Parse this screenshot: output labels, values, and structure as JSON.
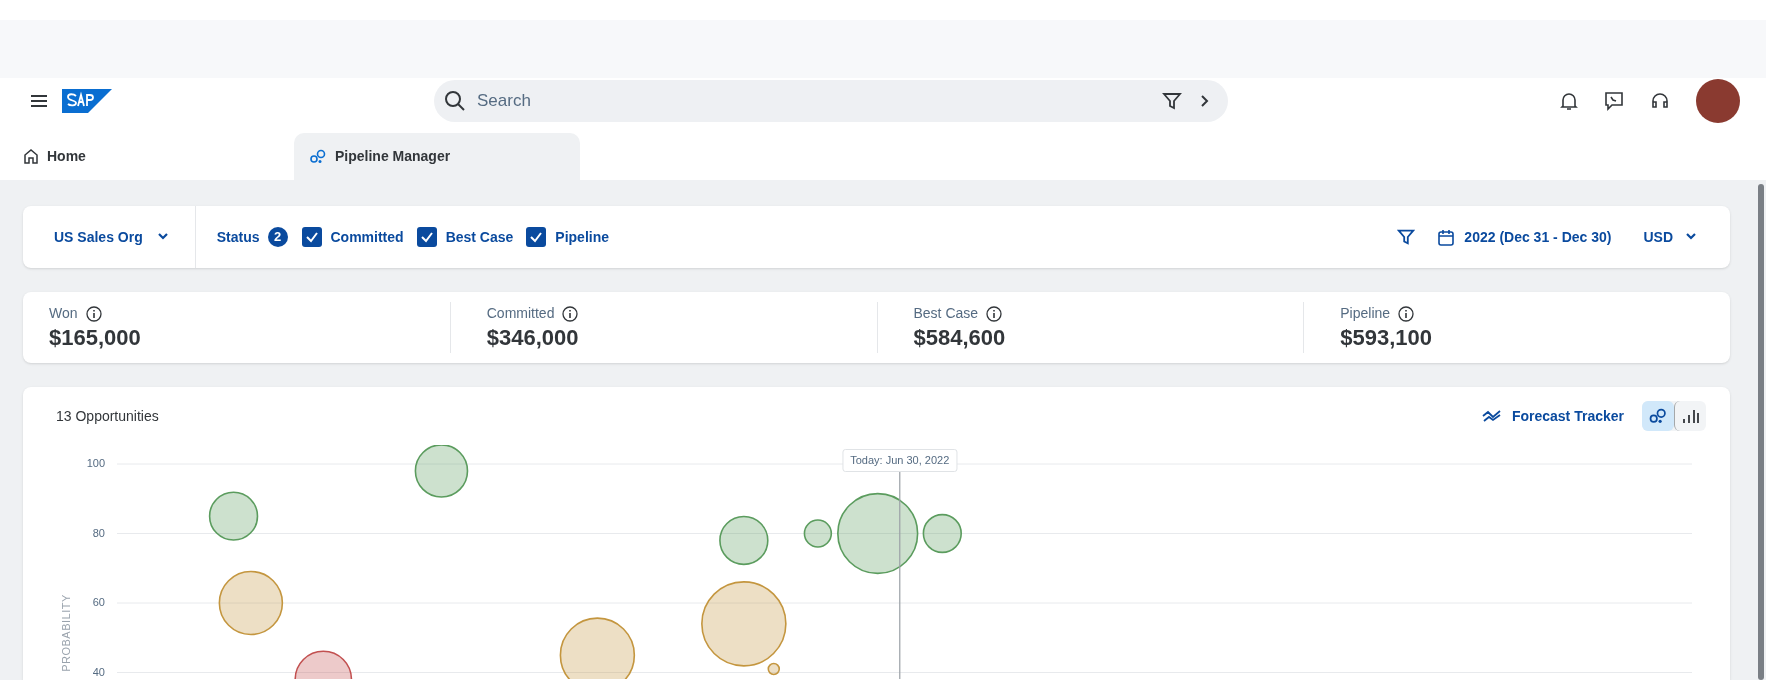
{
  "shell": {
    "search": {
      "placeholder": "Search"
    }
  },
  "tabs": [
    {
      "label": "Home",
      "selected": false,
      "kind": "home"
    },
    {
      "label": "Pipeline Manager",
      "selected": true,
      "kind": "pipeline"
    }
  ],
  "filter_bar": {
    "org": "US Sales Org",
    "status_label": "Status",
    "status_count": "2",
    "checkboxes": [
      {
        "label": "Committed",
        "checked": true
      },
      {
        "label": "Best Case",
        "checked": true
      },
      {
        "label": "Pipeline",
        "checked": true
      }
    ],
    "period": "2022 (Dec 31 - Dec 30)",
    "currency": "USD"
  },
  "kpis": [
    {
      "label": "Won",
      "value": "$165,000"
    },
    {
      "label": "Committed",
      "value": "$346,000"
    },
    {
      "label": "Best Case",
      "value": "$584,600"
    },
    {
      "label": "Pipeline",
      "value": "$593,100"
    }
  ],
  "chart_card": {
    "title": "13 Opportunities",
    "forecast_link": "Forecast Tracker",
    "view_toggle": [
      {
        "kind": "bubble",
        "selected": true
      },
      {
        "kind": "bar",
        "selected": false
      }
    ],
    "plot": {
      "y_axis_title": "PROBABILITY",
      "y_tick_labels": [
        "100",
        "80",
        "60",
        "40"
      ],
      "today_label": "Today: Jun 30, 2022"
    }
  }
}
